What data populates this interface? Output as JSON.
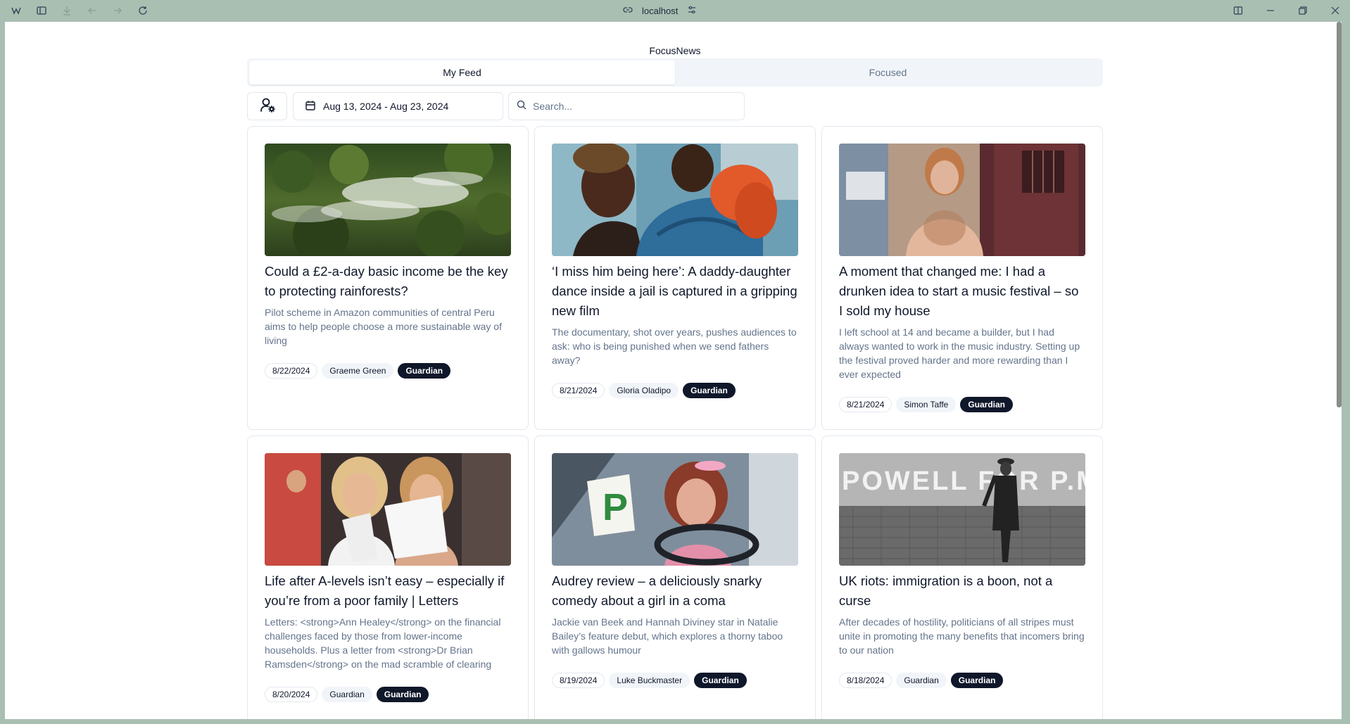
{
  "browser": {
    "address": "localhost"
  },
  "app": {
    "title": "FocusNews"
  },
  "tabs": [
    {
      "label": "My Feed",
      "active": true
    },
    {
      "label": "Focused",
      "active": false
    }
  ],
  "toolbar": {
    "date_range": "Aug 13, 2024 - Aug 23, 2024",
    "search_placeholder": "Search..."
  },
  "articles": [
    {
      "title": "Could a £2-a-day basic income be the key to protecting rainforests?",
      "summary": "Pilot scheme in Amazon communities of central Peru aims to help people choose a more sustainable way of living",
      "date": "8/22/2024",
      "author": "Graeme Green",
      "source": "Guardian",
      "image": "rainforest-aerial"
    },
    {
      "title": "‘I miss him being here’: A daddy-daughter dance inside a jail is captured in a gripping new film",
      "summary": "The documentary, shot over years, pushes audiences to ask: who is being punished when we send fathers away?",
      "date": "8/21/2024",
      "author": "Gloria Oladipo",
      "source": "Guardian",
      "image": "father-daughter-dance"
    },
    {
      "title": "A moment that changed me: I had a drunken idea to start a music festival – so I sold my house",
      "summary": "I left school at 14 and became a builder, but I had always wanted to work in the music industry. Setting up the festival proved harder and more rewarding than I ever expected",
      "date": "8/21/2024",
      "author": "Simon Taffe",
      "source": "Guardian",
      "image": "man-portrait"
    },
    {
      "title": "Life after A-levels isn’t easy – especially if you’re from a poor family | Letters",
      "summary": "Letters: <strong>Ann Healey</strong> on the financial challenges faced by those from lower-income households. Plus a letter from <strong>Dr Brian Ramsden</strong> on the mad scramble of clearing",
      "date": "8/20/2024",
      "author": "Guardian",
      "source": "Guardian",
      "image": "students-results"
    },
    {
      "title": "Audrey review – a deliciously snarky comedy about a girl in a coma",
      "summary": "Jackie van Beek and Hannah Diviney star in Natalie Bailey’s feature debut, which explores a thorny taboo with gallows humour",
      "date": "8/19/2024",
      "author": "Luke Buckmaster",
      "source": "Guardian",
      "image": "woman-driving"
    },
    {
      "title": "UK riots: immigration is a boon, not a curse",
      "summary": "After decades of hostility, politicians of all stripes must unite in promoting the many benefits that incomers bring to our nation",
      "date": "8/18/2024",
      "author": "Guardian",
      "source": "Guardian",
      "image": "graffiti-wall",
      "image_text": "POWELL FOR P.M.!"
    }
  ]
}
